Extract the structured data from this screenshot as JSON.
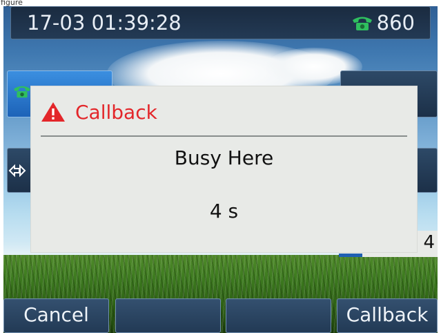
{
  "caption": "figure",
  "status_bar": {
    "datetime": "17-03 01:39:28",
    "account": "860",
    "account_icon": "phone-icon"
  },
  "side_keys": {
    "left_top_icon": "phone-icon",
    "left_middle_icon": "transfer-icon",
    "right_bottom_value": "4"
  },
  "dialog": {
    "icon": "warning-icon",
    "title": "Callback",
    "message": "Busy Here",
    "countdown": "4 s",
    "title_color": "#e3262a"
  },
  "softkeys": [
    {
      "label": "Cancel"
    },
    {
      "label": ""
    },
    {
      "label": ""
    },
    {
      "label": "Callback"
    }
  ]
}
